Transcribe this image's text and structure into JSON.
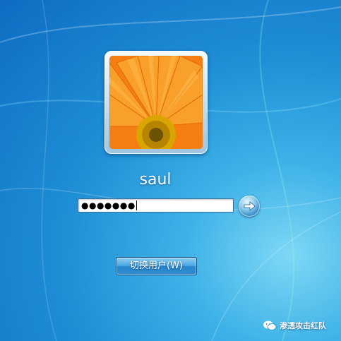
{
  "login": {
    "username": "saul",
    "password_display": "●●●●●●●",
    "switch_user_label": "切换用户(W)"
  },
  "icons": {
    "submit": "arrow-right-icon",
    "avatar": "flower-avatar",
    "watermark": "wechat-icon"
  },
  "watermark": {
    "text": "渗透攻击红队"
  },
  "colors": {
    "background": "#1f8fd6",
    "avatar_flower": "#f07a10",
    "text": "#ffffff"
  }
}
